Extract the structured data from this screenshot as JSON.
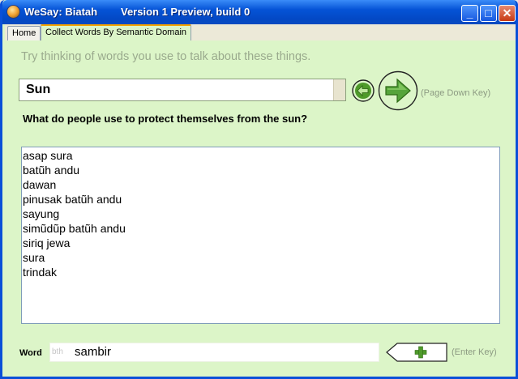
{
  "window": {
    "title": "WeSay: Biatah",
    "version": "Version 1 Preview, build 0",
    "controls": {
      "minimize": "_",
      "maximize": "□",
      "close": "✕"
    }
  },
  "tabs": [
    {
      "label": "Home",
      "active": false
    },
    {
      "label": "Collect Words By Semantic Domain",
      "active": true
    }
  ],
  "main": {
    "prompt": "Try thinking of words you use to talk about these things.",
    "domain": "Sun",
    "next_hint": "(Page Down Key)",
    "question": "What do people use to protect themselves from the sun?",
    "words": [
      "asap sura",
      "batũh andu",
      "dawan",
      "pinusak batũh andu",
      "sayung",
      "simũdũp batũh andu",
      "siriq jewa",
      "sura",
      "trindak"
    ],
    "word_entry": {
      "label": "Word",
      "writing_system": "bth",
      "value": "sambir",
      "add_hint": "(Enter Key)"
    }
  },
  "colors": {
    "panel_bg": "#dcf5c8",
    "accent_green": "#3f8f21",
    "tab_highlight": "#f5a300",
    "titlebar": "#0553d6"
  },
  "icons": {
    "prev": "arrow-left-icon",
    "next": "arrow-right-icon",
    "add": "plus-icon",
    "app": "wesay-icon"
  }
}
